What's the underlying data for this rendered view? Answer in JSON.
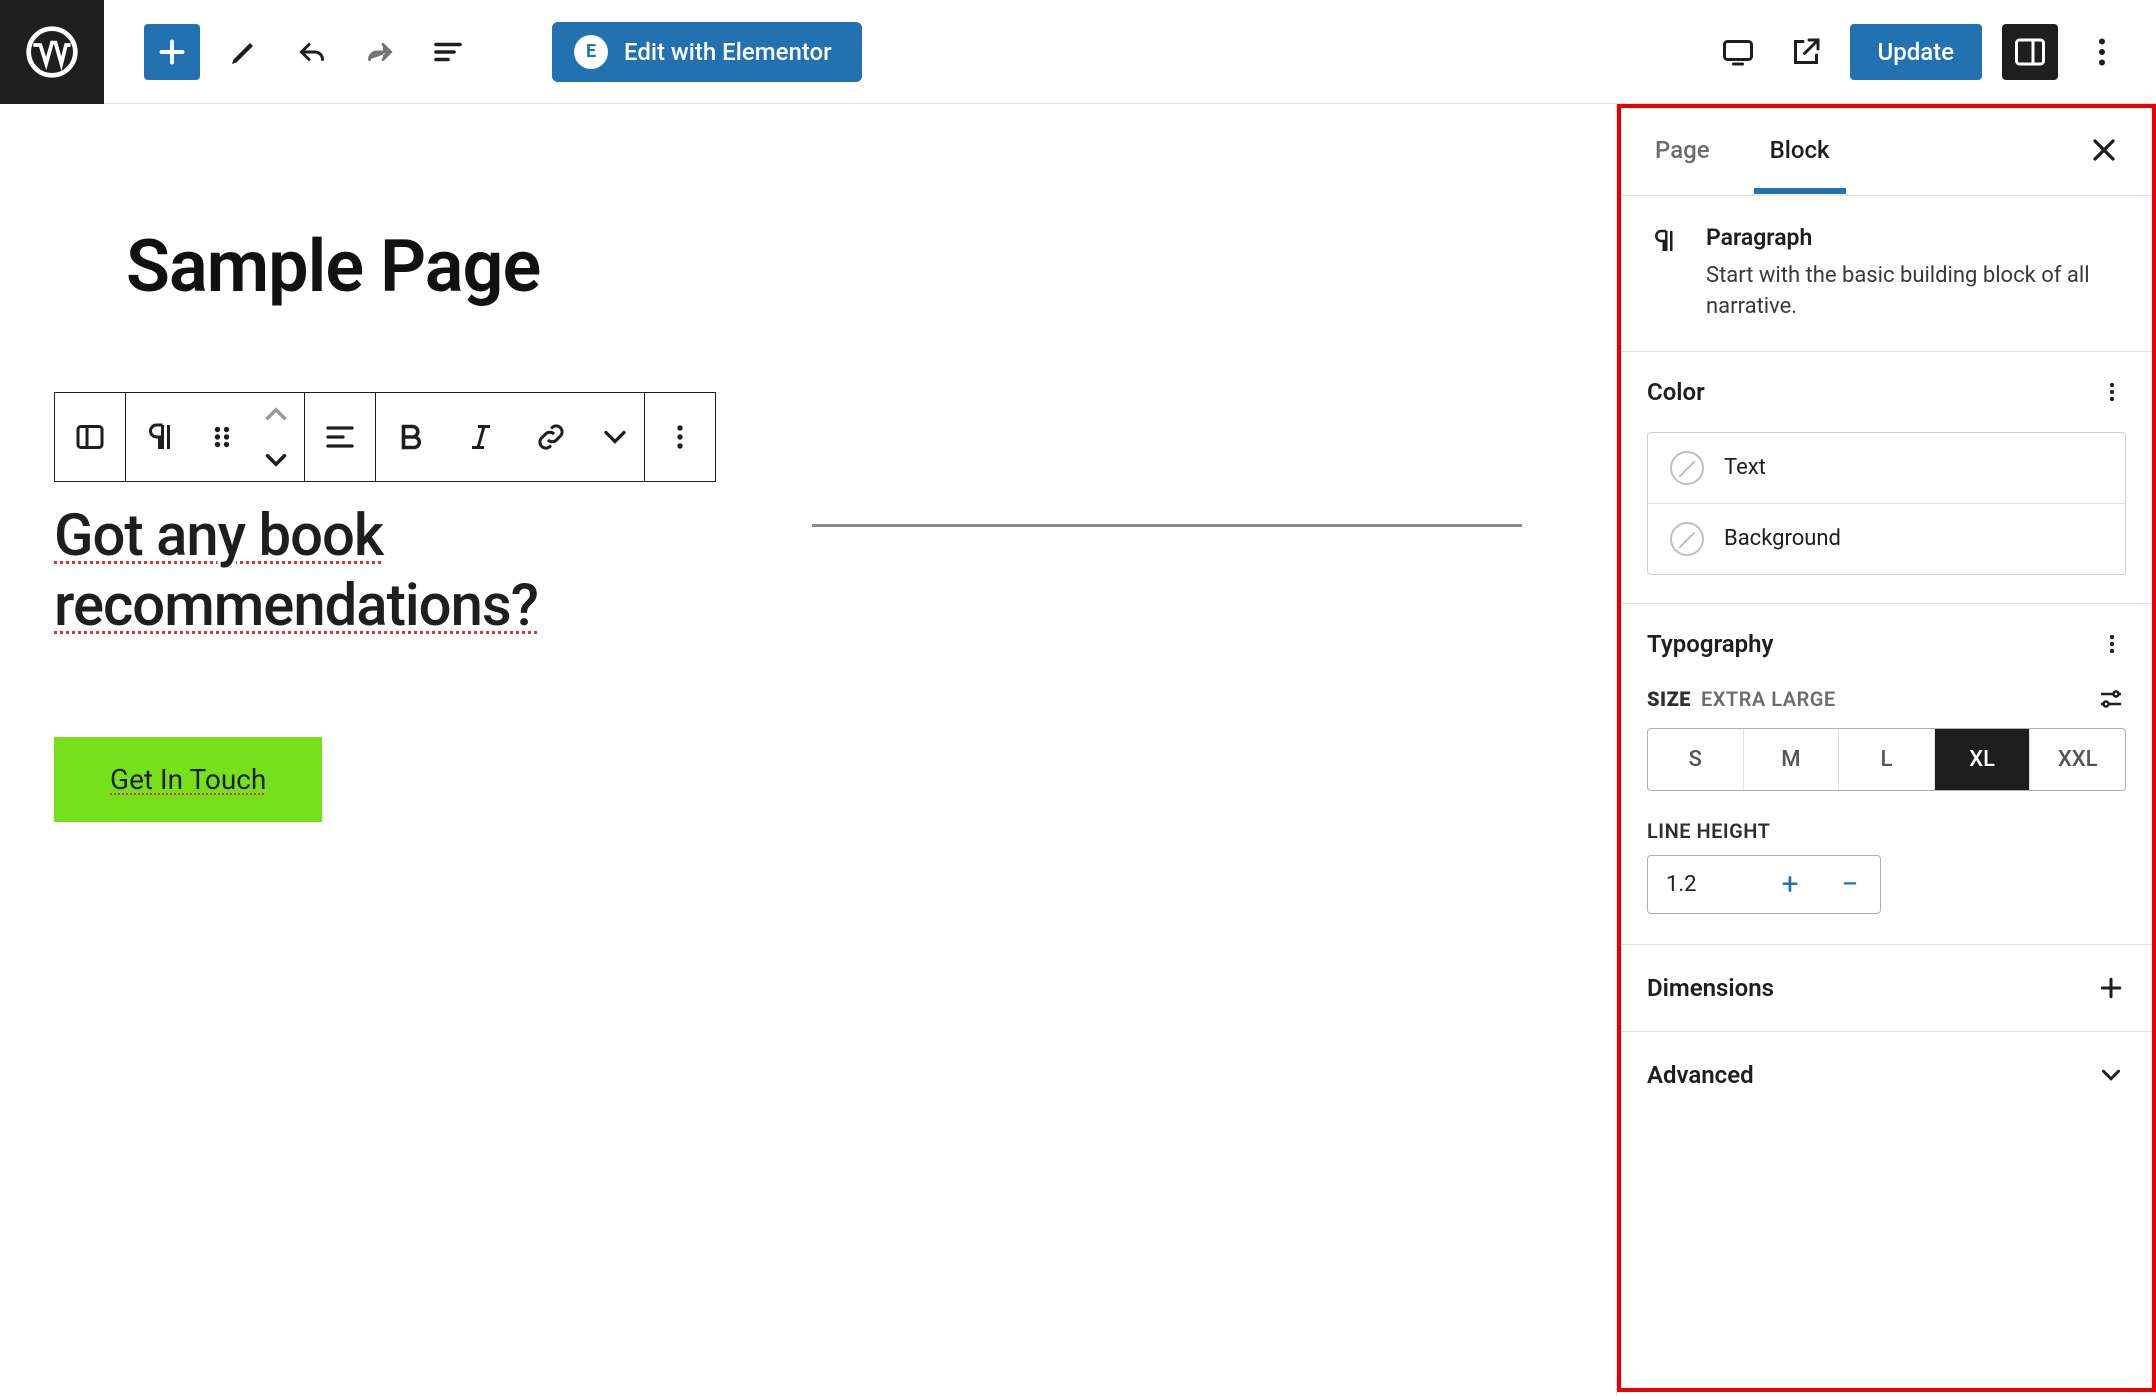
{
  "toolbar": {
    "edit_elementor_label": "Edit with Elementor",
    "update_label": "Update"
  },
  "editor": {
    "page_title": "Sample Page",
    "paragraph_line1": "Got any book",
    "paragraph_line2": "recommendations?",
    "button_label": "Get In Touch"
  },
  "sidebar": {
    "tabs": {
      "page": "Page",
      "block": "Block"
    },
    "block_info": {
      "name": "Paragraph",
      "description": "Start with the basic building block of all narrative."
    },
    "color": {
      "heading": "Color",
      "text": "Text",
      "background": "Background"
    },
    "typography": {
      "heading": "Typography",
      "size_label": "SIZE",
      "size_value_label": "EXTRA LARGE",
      "sizes": {
        "s": "S",
        "m": "M",
        "l": "L",
        "xl": "XL",
        "xxl": "XXL"
      },
      "line_height_label": "LINE HEIGHT",
      "line_height_value": "1.2"
    },
    "dimensions": {
      "heading": "Dimensions"
    },
    "advanced": {
      "heading": "Advanced"
    }
  }
}
